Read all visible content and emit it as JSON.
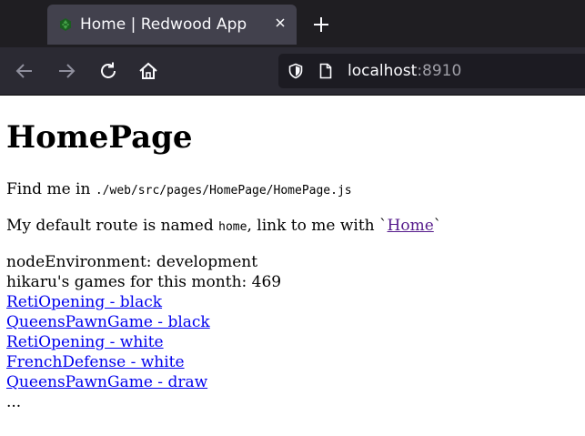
{
  "browser": {
    "tab": {
      "title": "Home | Redwood App"
    },
    "url": {
      "host": "localhost",
      "port": ":8910"
    }
  },
  "page": {
    "heading": "HomePage",
    "find_me": {
      "prefix": "Find me in ",
      "path": "./web/src/pages/HomePage/HomePage.js"
    },
    "route": {
      "prefix": "My default route is named ",
      "name": "home",
      "middle": ", link to me with `",
      "link_label": "Home",
      "suffix": "`"
    },
    "node_environment": "nodeEnvironment: development",
    "games_count_text": "hikaru's games for this month: 469",
    "games": [
      "RetiOpening - black",
      "QueensPawnGame - black",
      "RetiOpening - white",
      "FrenchDefense - white",
      "QueensPawnGame - draw"
    ],
    "ellipsis": "..."
  },
  "colors": {
    "tabbar_bg": "#1f1e22",
    "active_tab_bg": "#42414d",
    "toolbar_bg": "#2b2a33",
    "urlbar_bg": "#1c1b22",
    "link": "#0000ee",
    "visited_link": "#551a8b",
    "favicon": "#2e7d32"
  }
}
